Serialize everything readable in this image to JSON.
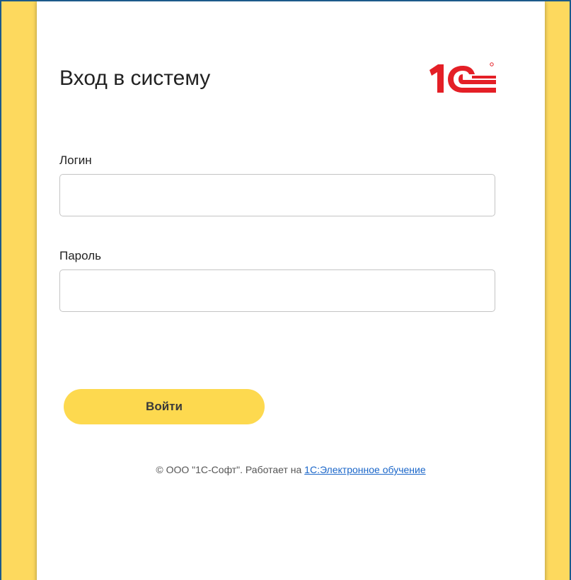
{
  "page": {
    "background_color": "#fdd95e",
    "accent_color": "#1e73be"
  },
  "form": {
    "title": "Вход в систему",
    "logo_icon": "1c-logo",
    "logo_color": "#e41f26",
    "login_label": "Логин",
    "login_value": "",
    "password_label": "Пароль",
    "password_value": "",
    "submit_label": "Войти",
    "submit_color": "#fdd94f"
  },
  "footer": {
    "copyright_text": "© ООО \"1С-Софт\". Работает на ",
    "link_text": "1С:Электронное обучение",
    "link_color": "#1a66c9"
  }
}
